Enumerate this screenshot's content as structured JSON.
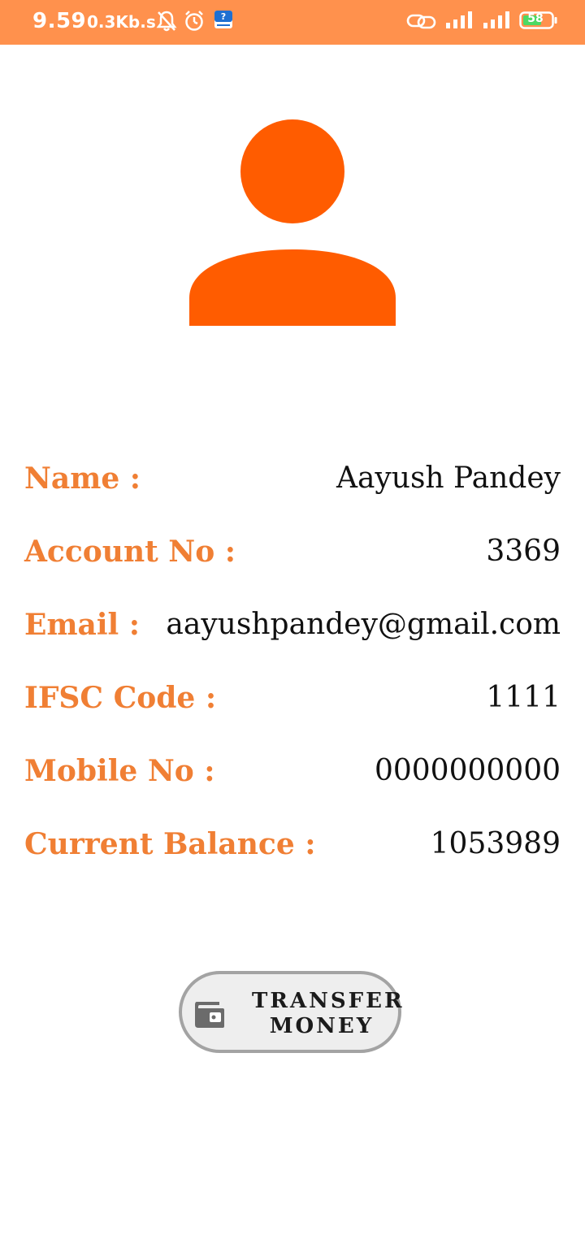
{
  "status_bar": {
    "time": "9.59",
    "network_speed": "0.3Kb.s",
    "battery_level": "58",
    "icons": [
      "bell-muted-icon",
      "alarm-icon",
      "app-notification-icon",
      "link-icon",
      "signal-icon",
      "signal-icon",
      "battery-icon"
    ],
    "background_color": "#ff914d"
  },
  "avatar": {
    "icon": "person-icon",
    "color": "#ff5c00"
  },
  "details": [
    {
      "label": "Name :",
      "value": "Aayush Pandey"
    },
    {
      "label": "Account No :",
      "value": "3369"
    },
    {
      "label": "Email :",
      "value": "aayushpandey@gmail.com"
    },
    {
      "label": "IFSC Code :",
      "value": "1111"
    },
    {
      "label": "Mobile No :",
      "value": "0000000000"
    },
    {
      "label": "Current Balance :",
      "value": "1053989"
    }
  ],
  "transfer_button": {
    "line1": "TRANSFER",
    "line2": "MONEY",
    "icon": "wallet-icon"
  },
  "colors": {
    "label": "#f07f34",
    "value": "#111111",
    "button_border": "#a3a3a3",
    "button_background": "#eeeeee"
  }
}
